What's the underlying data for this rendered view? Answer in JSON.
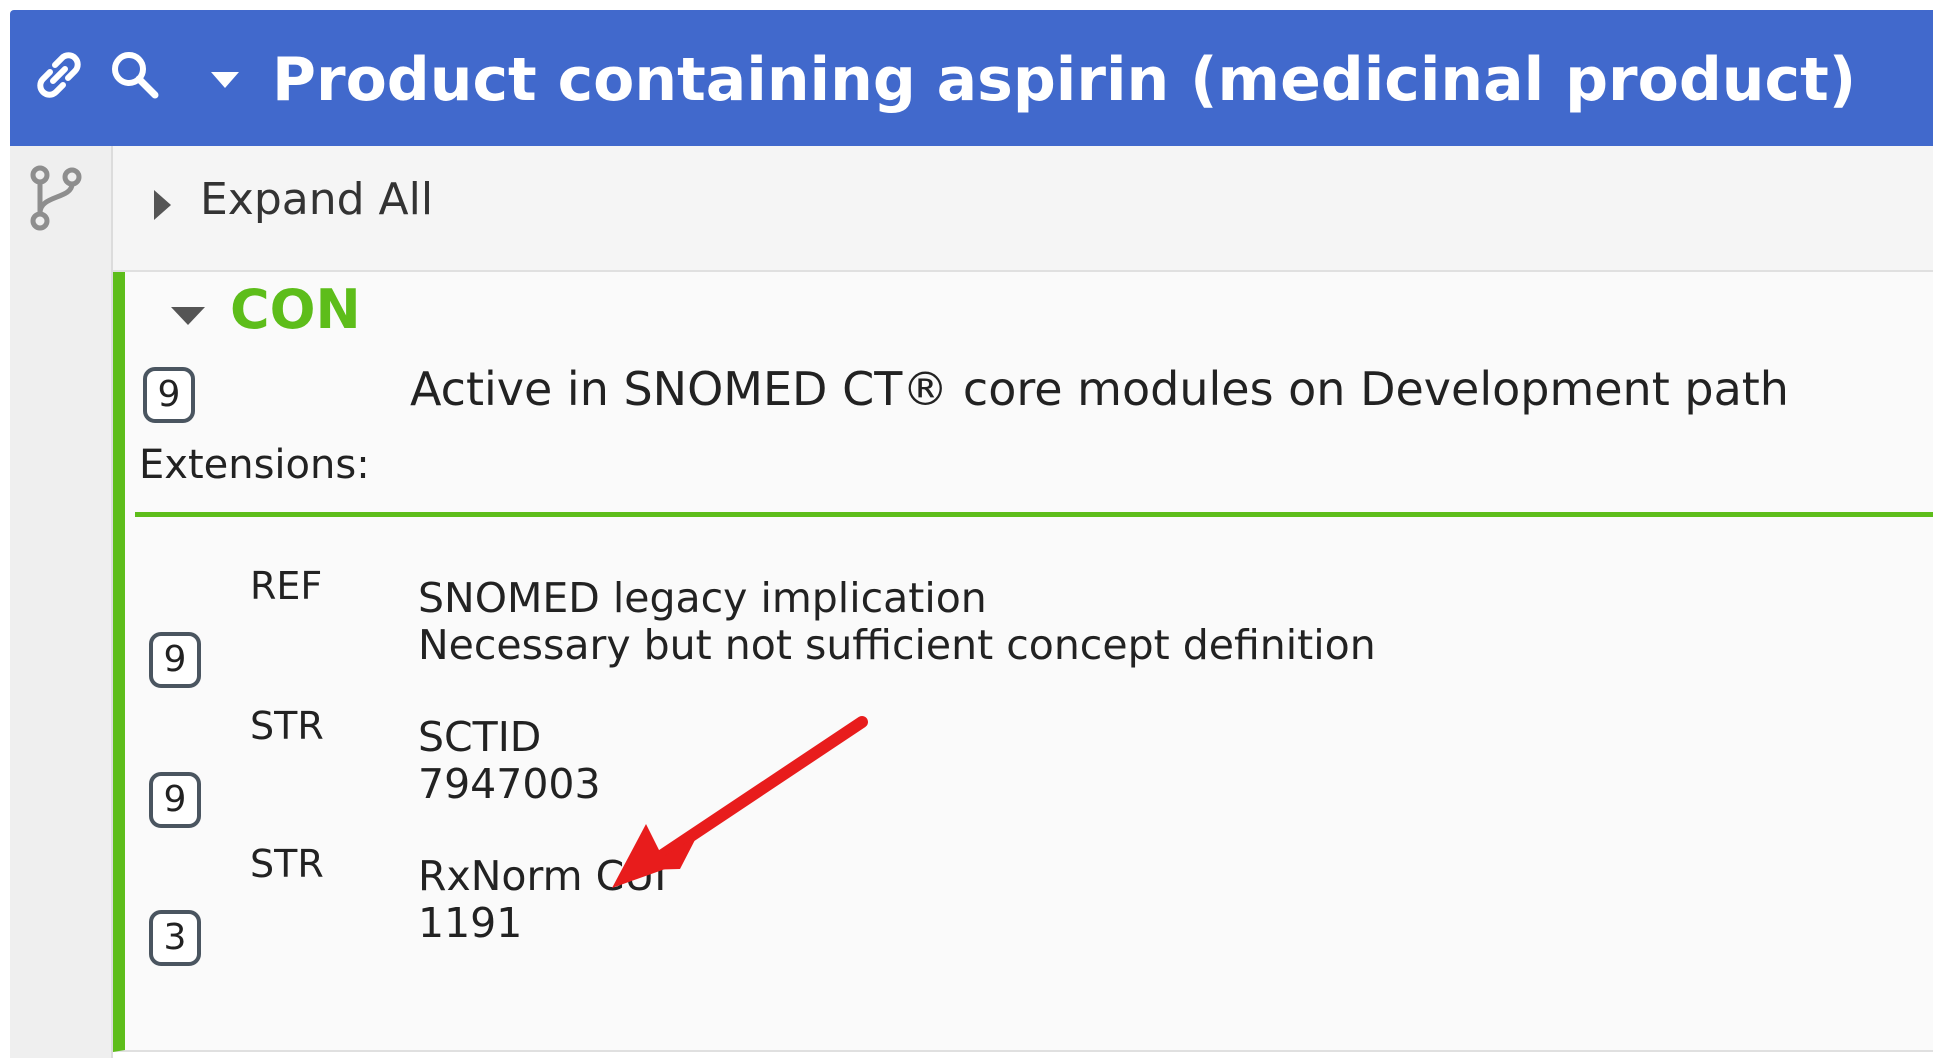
{
  "header": {
    "title": "Product containing aspirin (medicinal product)",
    "link_icon": "link-icon",
    "search_icon": "search-icon",
    "caret_icon": "caret-down-icon",
    "background_color": "#4169cc"
  },
  "sidebar": {
    "branch_icon": "git-branch-icon"
  },
  "expand_all": {
    "label": "Expand All",
    "icon": "caret-right-icon"
  },
  "concept": {
    "label": "CON",
    "accent_color": "#5dbd1a",
    "badge": "9",
    "status": "Active in SNOMED CT® core modules on Development path",
    "extensions_label": "Extensions:",
    "extensions": [
      {
        "type": "REF",
        "badge": "9",
        "lines": [
          "SNOMED legacy implication",
          "Necessary but not sufficient concept definition"
        ]
      },
      {
        "type": "STR",
        "badge": "9",
        "lines": [
          "SCTID",
          "7947003"
        ]
      },
      {
        "type": "STR",
        "badge": "3",
        "lines": [
          "RxNorm CUI",
          "1191"
        ]
      }
    ]
  },
  "annotation": {
    "arrow_icon": "red-arrow-icon",
    "arrow_color": "#e81c1c"
  }
}
